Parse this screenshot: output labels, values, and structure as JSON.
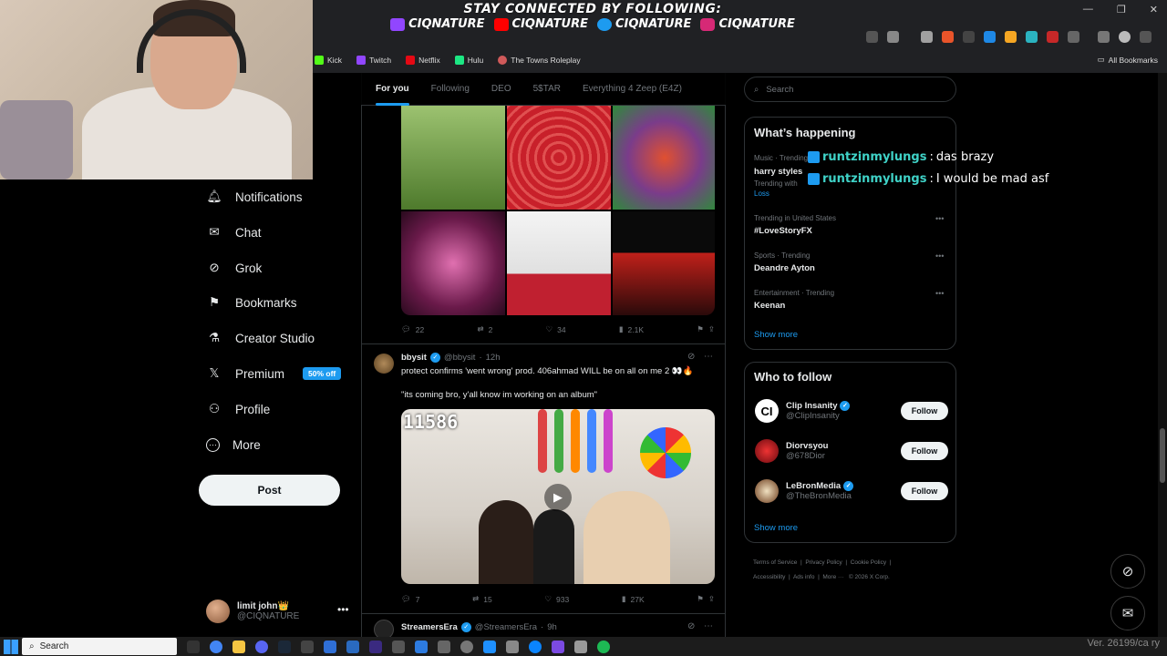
{
  "overlay": {
    "title": "STAY CONNECTED BY FOLLOWING:",
    "socials": [
      {
        "platform": "twitch",
        "handle": "CIQNATURE",
        "color": "#9146ff"
      },
      {
        "platform": "youtube",
        "handle": "CIQNATURE",
        "color": "#ff0000"
      },
      {
        "platform": "twitter",
        "handle": "CIQNATURE",
        "color": "#1d9bf0"
      },
      {
        "platform": "instagram",
        "handle": "CIQNATURE",
        "color": "#d62976"
      }
    ]
  },
  "window_controls": {
    "minimize": "—",
    "restore": "❐",
    "close": "✕"
  },
  "bookmarks": [
    {
      "label": "Kick",
      "color": "#53fc18"
    },
    {
      "label": "Twitch",
      "color": "#9146ff"
    },
    {
      "label": "Netflix",
      "color": "#e50914"
    },
    {
      "label": "Hulu",
      "color": "#1ce783"
    },
    {
      "label": "The Towns Roleplay",
      "color": "#d05a5a"
    }
  ],
  "all_bookmarks": "All Bookmarks",
  "nav": {
    "items": [
      {
        "label": "Notifications",
        "icon": "bell-icon",
        "glyph": "🔔︎"
      },
      {
        "label": "Chat",
        "icon": "mail-icon",
        "glyph": "✉"
      },
      {
        "label": "Grok",
        "icon": "grok-icon",
        "glyph": "⊘"
      },
      {
        "label": "Bookmarks",
        "icon": "bookmark-icon",
        "glyph": "⚑"
      },
      {
        "label": "Creator Studio",
        "icon": "flask-icon",
        "glyph": "⚗"
      },
      {
        "label": "Premium",
        "icon": "x-logo-icon",
        "glyph": "𝕏"
      },
      {
        "label": "Profile",
        "icon": "person-icon",
        "glyph": "⚇"
      },
      {
        "label": "More",
        "icon": "more-circle-icon",
        "glyph": "⋯"
      }
    ],
    "premium_badge": "50% off",
    "post_label": "Post"
  },
  "account": {
    "name": "limit john👑",
    "handle": "@CIQNATURE",
    "more": "•••"
  },
  "tabs": [
    "For you",
    "Following",
    "DEO",
    "5$TAR",
    "Everything 4 Zeep (E4Z)"
  ],
  "tweet1": {
    "image_colors": [
      "#5c8a3a",
      "#c8202a",
      "#7a3c8a",
      "#6a1a4a",
      "#f0f0f0",
      "#1a0a0a"
    ],
    "replies": "22",
    "reposts": "2",
    "likes": "34",
    "views": "2.1K"
  },
  "tweet2": {
    "name": "bbysit",
    "handle": "@bbysit",
    "time": "12h",
    "text1": "protect confirms 'went wrong' prod. 406ahmad WILL be on all on me 2 👀🔥",
    "text2": "\"its coming bro, y'all know im working on an album\"",
    "video_counter": "11586",
    "replies": "7",
    "reposts": "15",
    "likes": "933",
    "views": "27K"
  },
  "tweet3": {
    "name": "StreamersEra",
    "handle": "@StreamersEra",
    "time": "9h"
  },
  "search": {
    "placeholder": "Search"
  },
  "whats_happening": {
    "title": "What’s happening",
    "trends": [
      {
        "meta": "Music · Trending",
        "name": "harry styles",
        "extra": "Trending with",
        "extra2": "Loss"
      },
      {
        "meta": "Trending in United States",
        "name": "#LoveStoryFX"
      },
      {
        "meta": "Sports · Trending",
        "name": "Deandre Ayton"
      },
      {
        "meta": "Entertainment · Trending",
        "name": "Keenan"
      }
    ],
    "show_more": "Show more"
  },
  "who_to_follow": {
    "title": "Who to follow",
    "accounts": [
      {
        "name": "Clip Insanity",
        "handle": "@ClipInsanity",
        "verified": true,
        "avatar_text": "CI",
        "avatar_bg": "#ffffff",
        "avatar_fg": "#000000"
      },
      {
        "name": "Diorvsyou",
        "handle": "@678Dior",
        "verified": false,
        "avatar_text": "",
        "avatar_bg": "#b3121c",
        "avatar_fg": "#ffffff"
      },
      {
        "name": "LeBronMedia",
        "handle": "@TheBronMedia",
        "verified": true,
        "avatar_text": "",
        "avatar_bg": "#e8e8e8",
        "avatar_fg": "#552583"
      }
    ],
    "follow_label": "Follow",
    "show_more": "Show more"
  },
  "footer": {
    "line1": [
      "Terms of Service",
      "Privacy Policy",
      "Cookie Policy"
    ],
    "line2": [
      "Accessibility",
      "Ads info",
      "More ···",
      "© 2026 X Corp."
    ]
  },
  "chat": [
    {
      "user": "runtzinmylungs",
      "message": "das brazy"
    },
    {
      "user": "runtzinmylungs",
      "message": "I would be mad asf"
    }
  ],
  "taskbar": {
    "search_label": "Search",
    "version": "Ver. 26199/ca ry"
  },
  "colors": {
    "accent": "#1d9bf0",
    "background": "#000000",
    "border": "#2f3336",
    "muted": "#71767b"
  }
}
